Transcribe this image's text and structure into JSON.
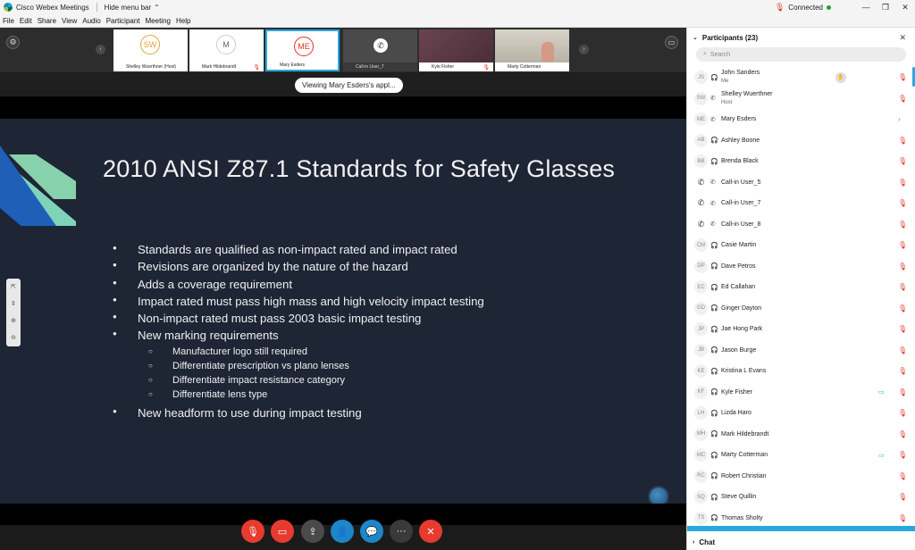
{
  "window": {
    "title": "Cisco Webex Meetings",
    "hide_menu": "Hide menu bar",
    "status": "Connected",
    "min_icon": "—",
    "restore_icon": "❐",
    "close_icon": "✕"
  },
  "menu": [
    "File",
    "Edit",
    "Share",
    "View",
    "Audio",
    "Participant",
    "Meeting",
    "Help"
  ],
  "strip": {
    "tiles": [
      {
        "initials": "SW",
        "caption": "Shelley Wuerthner (Host)",
        "color": "#e6a23c"
      },
      {
        "initials": "M",
        "caption": "Mark Hildebrandt",
        "color": "#888888"
      },
      {
        "initials": "ME",
        "caption": "Mary Esders",
        "color": "#e0301e"
      },
      {
        "initials": "",
        "caption": "Call-in User_7",
        "color": "#888888"
      },
      {
        "initials": "",
        "caption": "Kyle Fisher",
        "color": "#888888"
      },
      {
        "initials": "",
        "caption": "Marty Cotterman",
        "color": "#888888"
      }
    ]
  },
  "banner": "Viewing Mary Esders's appl...",
  "slide": {
    "title": "2010 ANSI Z87.1 Standards for Safety Glasses",
    "bullets": [
      "Standards are qualified as non-impact rated and impact rated",
      "Revisions are organized by the nature of the hazard",
      "Adds a coverage requirement",
      "Impact rated must pass high mass and high velocity impact testing",
      "Non-impact rated must pass 2003 basic impact testing",
      "New marking requirements"
    ],
    "sub_bullets": [
      "Manufacturer logo still required",
      "Differentiate prescription vs plano lenses",
      "Differentiate impact resistance category",
      "Differentiate lens type"
    ],
    "last_bullet": "New headform to use during impact testing"
  },
  "panel": {
    "title": "Participants (23)",
    "search_placeholder": "Search",
    "chat_label": "Chat",
    "participants": [
      {
        "initials": "JS",
        "name": "John Sanders",
        "sub": "Me",
        "device": "headset",
        "hand": true
      },
      {
        "initials": "SW",
        "name": "Shelley Wuerthner",
        "sub": "Host",
        "device": "phone"
      },
      {
        "initials": "ME",
        "name": "Mary Esders",
        "sub": "",
        "device": "phone"
      },
      {
        "initials": "AB",
        "name": "Ashley Boone",
        "sub": "",
        "device": "headset"
      },
      {
        "initials": "BB",
        "name": "Brenda Black",
        "sub": "",
        "device": "headset"
      },
      {
        "initials": "",
        "name": "Call-in User_5",
        "sub": "",
        "device": "phone"
      },
      {
        "initials": "",
        "name": "Call-in User_7",
        "sub": "",
        "device": "phone"
      },
      {
        "initials": "",
        "name": "Call-in User_8",
        "sub": "",
        "device": "phone"
      },
      {
        "initials": "CM",
        "name": "Casie Martin",
        "sub": "",
        "device": "headset"
      },
      {
        "initials": "DP",
        "name": "Dave Petros",
        "sub": "",
        "device": "headset"
      },
      {
        "initials": "EC",
        "name": "Ed Callahan",
        "sub": "",
        "device": "headset"
      },
      {
        "initials": "GD",
        "name": "Ginger Dayton",
        "sub": "",
        "device": "headset"
      },
      {
        "initials": "JP",
        "name": "Jae Hong Park",
        "sub": "",
        "device": "headset"
      },
      {
        "initials": "JB",
        "name": "Jason Burge",
        "sub": "",
        "device": "headset"
      },
      {
        "initials": "KE",
        "name": "Kristina L Evans",
        "sub": "",
        "device": "headset"
      },
      {
        "initials": "KF",
        "name": "Kyle Fisher",
        "sub": "",
        "device": "headset",
        "camera": true
      },
      {
        "initials": "LH",
        "name": "Lizda Haro",
        "sub": "",
        "device": "headset"
      },
      {
        "initials": "MH",
        "name": "Mark Hildebrandt",
        "sub": "",
        "device": "headset"
      },
      {
        "initials": "MC",
        "name": "Marty Cotterman",
        "sub": "",
        "device": "headset",
        "camera": true
      },
      {
        "initials": "RC",
        "name": "Robert Christian",
        "sub": "",
        "device": "headset"
      },
      {
        "initials": "SQ",
        "name": "Steve Quillin",
        "sub": "",
        "device": "headset"
      },
      {
        "initials": "TS",
        "name": "Thomas Sholty",
        "sub": "",
        "device": "headset"
      }
    ]
  },
  "colors": {
    "accent": "#27a9e0",
    "mute_red": "#e0301e",
    "end_red": "#e63b2e"
  }
}
